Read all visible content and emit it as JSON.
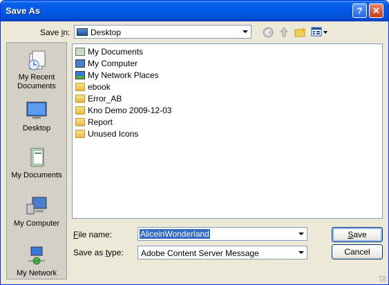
{
  "window": {
    "title": "Save As"
  },
  "toolbar": {
    "save_in_label": "Save in:",
    "location": "Desktop"
  },
  "places": [
    {
      "label": "My Recent\nDocuments",
      "icon": "recent-documents-icon"
    },
    {
      "label": "Desktop",
      "icon": "desktop-icon"
    },
    {
      "label": "My Documents",
      "icon": "my-documents-icon"
    },
    {
      "label": "My Computer",
      "icon": "my-computer-icon"
    },
    {
      "label": "My Network",
      "icon": "my-network-icon"
    }
  ],
  "files": [
    {
      "name": "My Documents",
      "icon": "my-documents-icon"
    },
    {
      "name": "My Computer",
      "icon": "my-computer-icon"
    },
    {
      "name": "My Network Places",
      "icon": "network-places-icon"
    },
    {
      "name": "ebook",
      "icon": "folder-icon"
    },
    {
      "name": "Error_AB",
      "icon": "folder-icon"
    },
    {
      "name": "Kno Demo 2009-12-03",
      "icon": "folder-icon"
    },
    {
      "name": "Report",
      "icon": "folder-icon"
    },
    {
      "name": "Unused Icons",
      "icon": "folder-icon"
    }
  ],
  "form": {
    "file_name_label": "File name:",
    "file_name_value": "AliceinWonderland",
    "save_as_type_label": "Save as type:",
    "save_as_type_value": "Adobe Content Server Message"
  },
  "buttons": {
    "save": "Save",
    "cancel": "Cancel"
  }
}
